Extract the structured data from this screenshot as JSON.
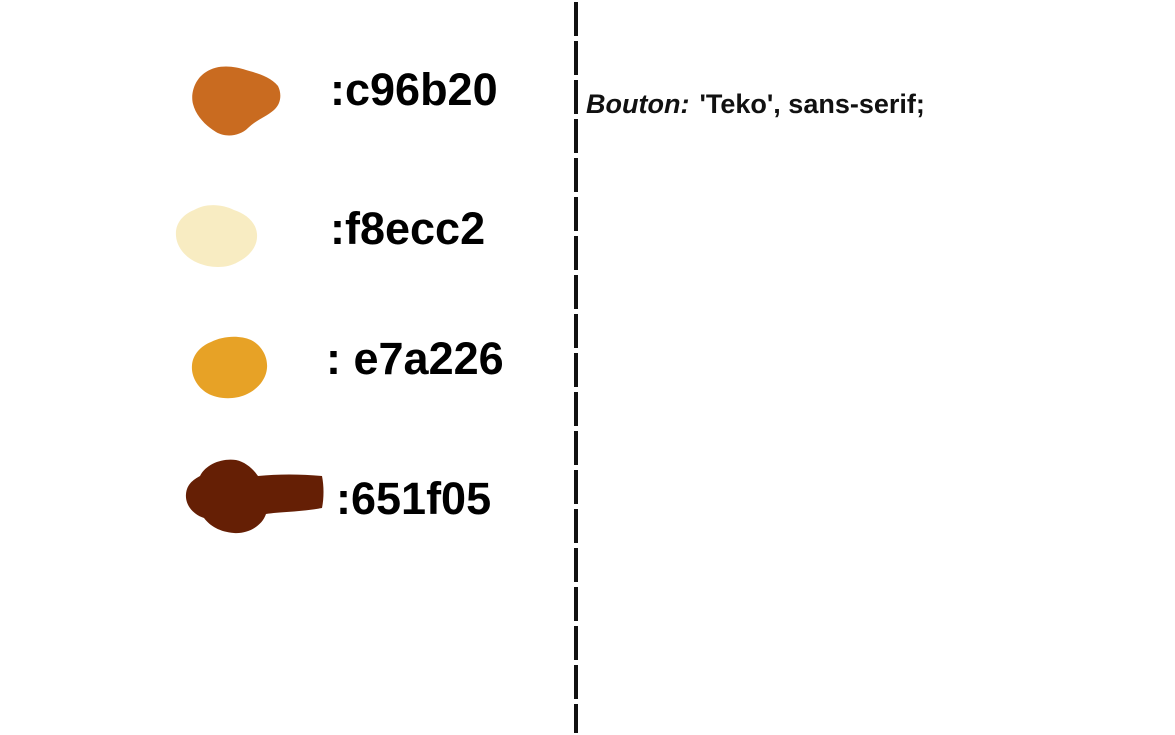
{
  "palette": {
    "colors": [
      {
        "label": ":c96b20",
        "hex": "#c96b20"
      },
      {
        "label": ":f8ecc2",
        "hex": "#f8ecc2"
      },
      {
        "label": ": e7a226",
        "hex": "#e7a226"
      },
      {
        "label": ":651f05",
        "hex": "#651f05"
      }
    ]
  },
  "font_note": {
    "key": "Bouton:",
    "value": "'Teko', sans-serif;"
  },
  "divider": {
    "color": "#111111",
    "style": "dashed"
  }
}
